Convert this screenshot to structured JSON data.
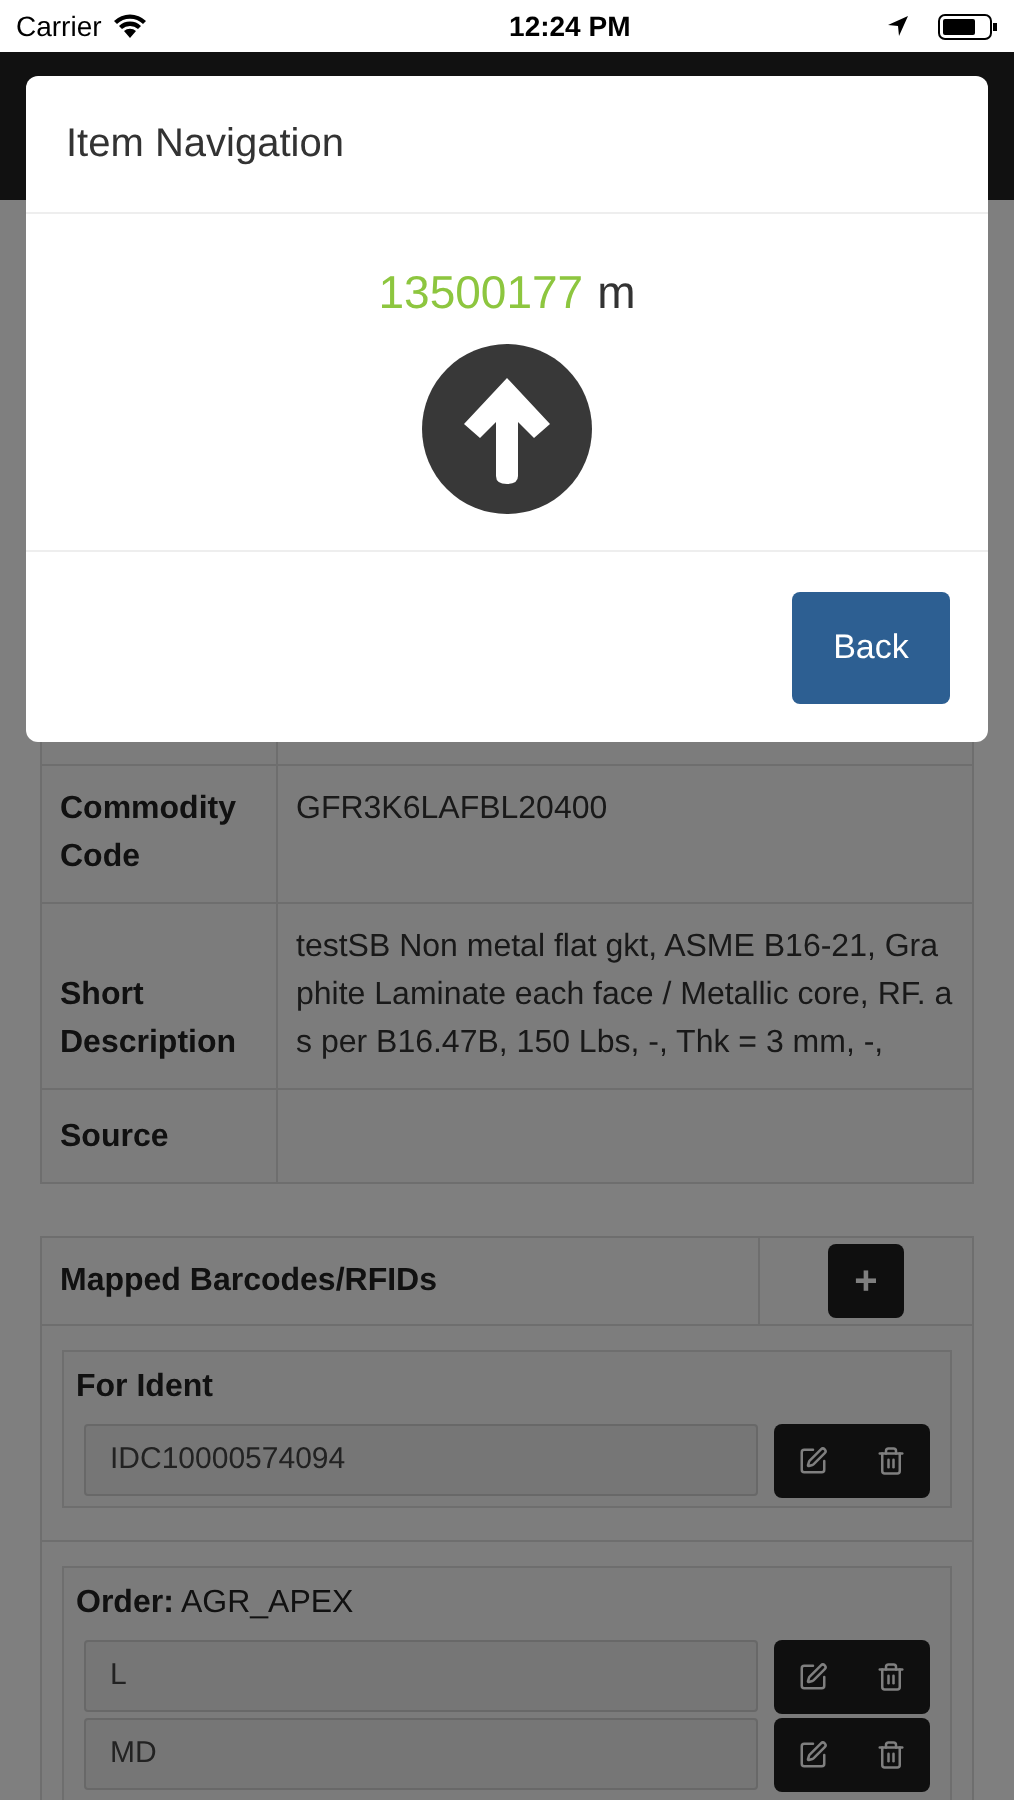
{
  "status_bar": {
    "carrier": "Carrier",
    "time": "12:24 PM"
  },
  "details": [
    {
      "label": "Commodity Code",
      "value": "GFR3K6LAFBL20400"
    },
    {
      "label": "Short Description",
      "value": "testSB Non metal flat gkt, ASME B16-21, Graphite Laminate each face / Metallic core, RF. as per B16.47B, 150 Lbs, -, Thk = 3 mm, -,"
    },
    {
      "label": "Source"
    }
  ],
  "barcodes": {
    "title": "Mapped Barcodes/RFIDs",
    "add_button": "+",
    "groups": [
      {
        "kind": "ident",
        "heading": "For Ident",
        "items": [
          "IDC10000574094"
        ]
      },
      {
        "kind": "order",
        "heading": "**Order:** AGR_APEX",
        "items": [
          "L",
          "MD"
        ]
      }
    ]
  },
  "modal": {
    "title": "Item Navigation",
    "distance": "13500177",
    "unit": "m",
    "button": "Back"
  }
}
